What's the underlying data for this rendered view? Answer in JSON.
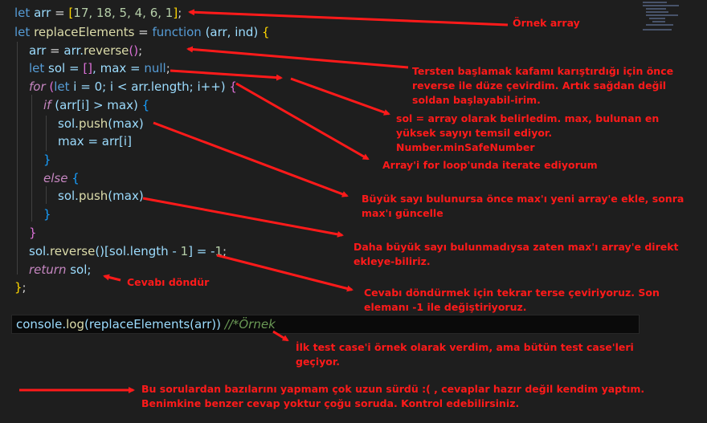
{
  "code": {
    "line1": {
      "kw": "let",
      "var": "arr",
      "eq": " = ",
      "open": "[",
      "nums": "17, 18, 5, 4, 6, 1",
      "close": "]",
      "end": ";"
    },
    "line2": {
      "kw": "let",
      "var": "replaceElements",
      "eq": " = ",
      "fnkw": "function",
      "params": " (arr, ind) ",
      "brace": "{"
    },
    "line3": {
      "lhs": "arr",
      "eq": " = ",
      "obj": "arr.",
      "fn": "reverse",
      "paren": "()",
      "end": ";"
    },
    "line4": {
      "kw": "let",
      "rest1": " sol = ",
      "arr": "[]",
      "rest2": ", max = ",
      "nul": "null",
      "end": ";"
    },
    "line5": {
      "kw": "for",
      "open": " (",
      "let": "let",
      "rest": " i = 0; i < arr.length; i++) ",
      "brace": "{"
    },
    "line6": {
      "kw": "if",
      "rest": " (arr[i] > max) ",
      "brace": "{"
    },
    "line7": {
      "obj": "sol.",
      "fn": "push",
      "rest": "(max)"
    },
    "line8": {
      "text": "max = arr[i]"
    },
    "line9": {
      "brace": "}"
    },
    "line10": {
      "kw": "else",
      "brace": " {"
    },
    "line11": {
      "obj": "sol.",
      "fn": "push",
      "rest": "(max)"
    },
    "line12": {
      "brace": "}"
    },
    "line13": {
      "brace": "}"
    },
    "line14": {
      "obj": "sol.",
      "fn": "reverse",
      "rest": "()[sol.length - ",
      "num": "1",
      "rest2": "] = -",
      "num2": "1",
      "end": ";"
    },
    "line15": {
      "kw": "return",
      "rest": " sol;"
    },
    "line16": {
      "brace": "}",
      "end": ";"
    },
    "line17": {
      "obj": "console.",
      "fn": "log",
      "rest": "(replaceElements(arr)) ",
      "cmt": "//*Örnek"
    }
  },
  "annotations": {
    "a1": "Örnek array",
    "a2": "Tersten başlamak kafamı karıştırdığı için önce reverse ile düze çevirdim. Artık sağdan değil soldan başlayabil-irim.",
    "a3": "sol = array olarak belirledim. max, bulunan en yüksek sayıyı temsil ediyor. Number.minSafeNumber",
    "a4": "Array'i for loop'unda iterate ediyorum",
    "a5": "Büyük sayı bulunursa önce max'ı yeni array'e ekle, sonra max'ı güncelle",
    "a6": "Daha büyük sayı bulunmadıysa zaten max'ı array'e direkt ekleye-biliriz.",
    "a7": "Cevabı döndür",
    "a8": "Cevabı döndürmek için tekrar terse çeviriyoruz. Son elemanı -1 ile değiştiriyoruz.",
    "a9": "İlk test case'i örnek olarak verdim, ama bütün test case'leri geçiyor.",
    "a10": "Bu sorulardan bazılarını yapmam çok uzun sürdü :( , cevaplar hazır değil kendim yaptım. Benimkine benzer cevap yoktur çoğu soruda. Kontrol edebilirsiniz."
  },
  "colors": {
    "annotation": "#ff1a1a",
    "background": "#1e1e1e"
  }
}
